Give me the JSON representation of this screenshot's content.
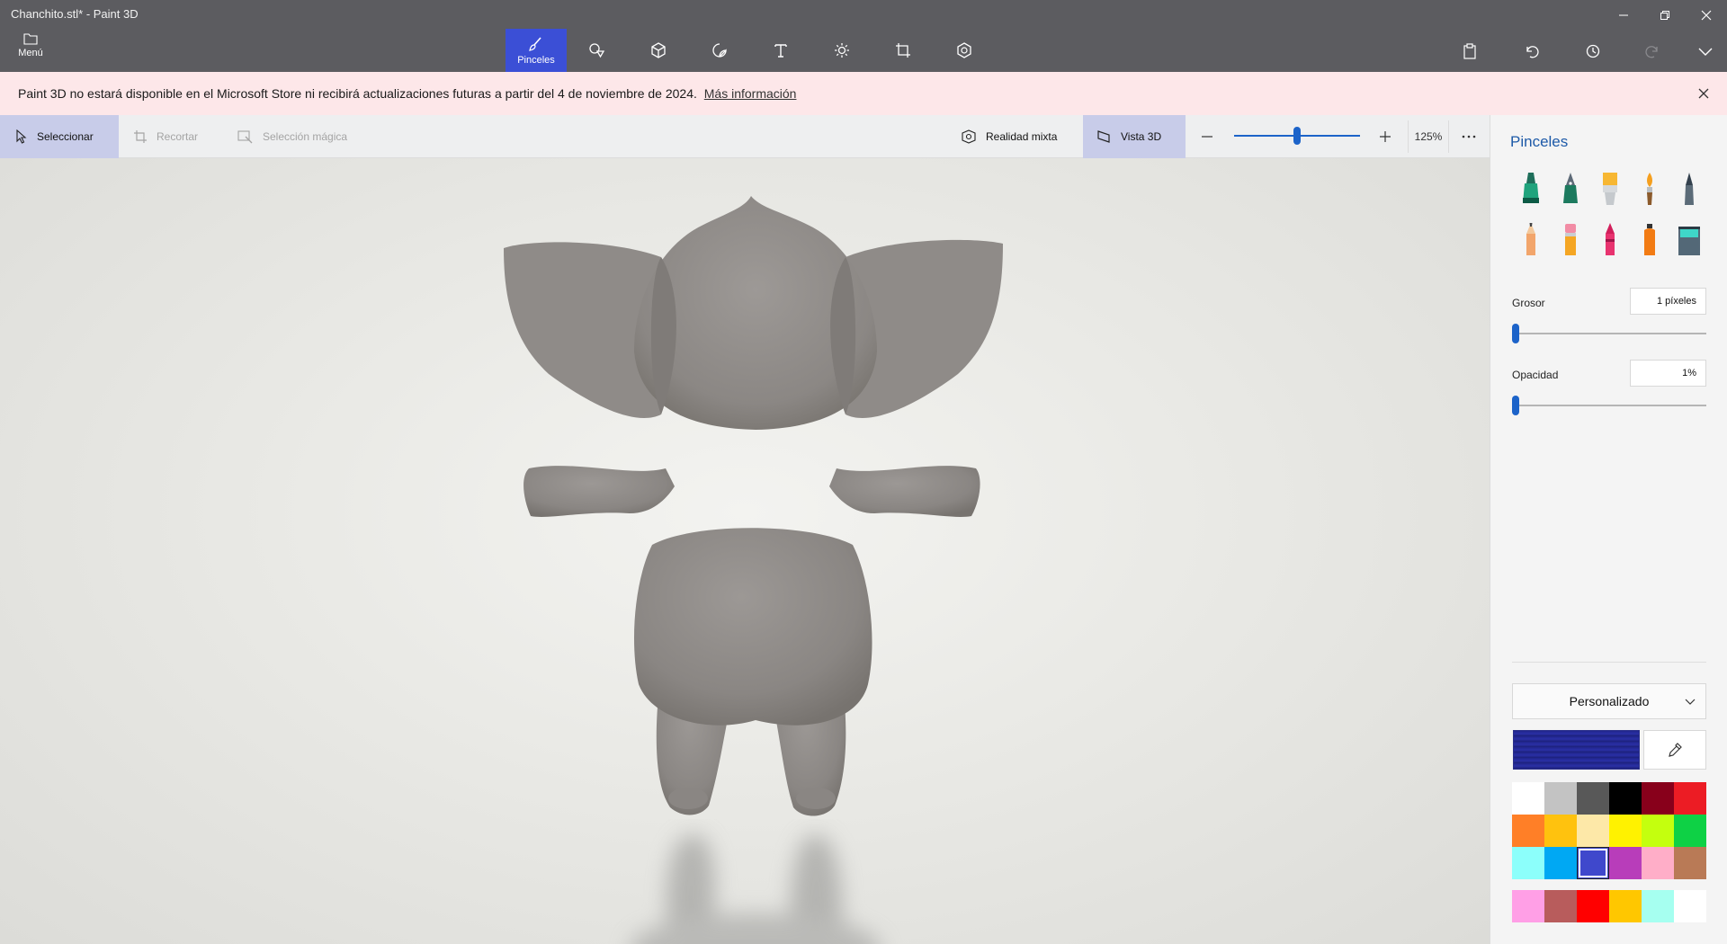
{
  "window": {
    "title": "Chanchito.stl* - Paint 3D",
    "controls": [
      "minimize",
      "restore",
      "close"
    ]
  },
  "menu": {
    "label": "Menú",
    "icon": "folder-icon"
  },
  "toolbar": {
    "tools": [
      {
        "id": "brushes",
        "label": "Pinceles",
        "icon": "brush-icon",
        "active": true
      },
      {
        "id": "2d-shapes",
        "label": "",
        "icon": "2d-shapes-icon"
      },
      {
        "id": "3d-shapes",
        "label": "",
        "icon": "3d-shapes-icon"
      },
      {
        "id": "stickers",
        "label": "",
        "icon": "stickers-icon"
      },
      {
        "id": "text",
        "label": "",
        "icon": "text-icon"
      },
      {
        "id": "effects",
        "label": "",
        "icon": "effects-icon"
      },
      {
        "id": "canvas",
        "label": "",
        "icon": "canvas-icon"
      },
      {
        "id": "3d-library",
        "label": "",
        "icon": "3d-library-icon"
      }
    ],
    "right_tools": [
      "paste-icon",
      "undo-icon",
      "history-icon",
      "redo-icon",
      "expand-icon"
    ]
  },
  "notice": {
    "text": "Paint 3D no estará disponible en el Microsoft Store ni recibirá actualizaciones futuras a partir del 4 de noviembre de 2024.",
    "link": "Más información"
  },
  "actions": {
    "select": "Seleccionar",
    "crop": "Recortar",
    "magic_select": "Selección mágica",
    "mixed_reality": "Realidad mixta",
    "view_3d": "Vista 3D",
    "zoom_percent": "125%",
    "zoom_level": 0.5
  },
  "panel": {
    "title": "Pinceles",
    "brushes": [
      "marker-icon",
      "calligraphy-pen-icon",
      "oil-brush-icon",
      "watercolor-icon",
      "pixel-pen-icon",
      "pencil-icon",
      "eraser-icon",
      "crayon-icon",
      "spray-can-icon",
      "fill-icon"
    ],
    "thickness_label": "Grosor",
    "thickness_value": "1 píxeles",
    "thickness_level": 0.0,
    "opacity_label": "Opacidad",
    "opacity_value": "1%",
    "opacity_level": 0.0,
    "palette_selector": "Personalizado",
    "current_color": "#2328a0",
    "swatches": [
      "#ffffff",
      "#c3c3c3",
      "#585858",
      "#000000",
      "#88001b",
      "#ec1c24",
      "#ff7f27",
      "#ffc20e",
      "#fde8a8",
      "#fff200",
      "#c4ff0e",
      "#0ed145",
      "#8cfffb",
      "#00a8f3",
      "#3f48cc",
      "#b83dba",
      "#ffaec8",
      "#b97a56"
    ],
    "selected_swatch": 14,
    "custom_swatches": [
      "#ff9fe6",
      "#b85c5c",
      "#ff0000",
      "#ffc700",
      "#a6fff0",
      "#ffffff"
    ]
  }
}
